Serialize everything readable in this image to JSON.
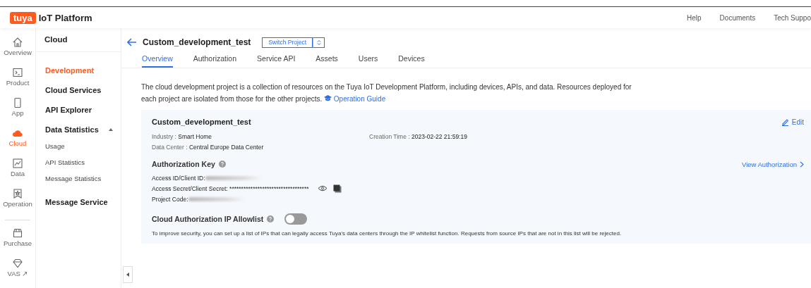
{
  "header": {
    "logo": "tuya",
    "title": "IoT Platform",
    "links": [
      "Help",
      "Documents",
      "Tech Suppo"
    ]
  },
  "rail": [
    {
      "label": "Overview",
      "selected": false
    },
    {
      "label": "Product",
      "selected": false
    },
    {
      "label": "App",
      "selected": false
    },
    {
      "label": "Cloud",
      "selected": true
    },
    {
      "label": "Data",
      "selected": false
    },
    {
      "label": "Operation",
      "selected": false
    },
    {
      "label": "Purchase",
      "selected": false
    },
    {
      "label": "VAS ↗",
      "selected": false
    }
  ],
  "sidebar": {
    "title": "Cloud",
    "items": [
      {
        "label": "Development",
        "selected": true
      },
      {
        "label": "Cloud Services",
        "selected": false
      },
      {
        "label": "API Explorer",
        "selected": false
      },
      {
        "label": "Data Statistics",
        "selected": false,
        "expanded": true,
        "children": [
          {
            "label": "Usage",
            "selected": false
          },
          {
            "label": "API Statistics",
            "selected": false
          },
          {
            "label": "Message Statistics",
            "selected": false
          }
        ]
      },
      {
        "label": "Message Service",
        "selected": false
      }
    ]
  },
  "project": {
    "name": "Custom_development_test",
    "switch_button": "Switch Project"
  },
  "tabs": [
    {
      "label": "Overview",
      "selected": true
    },
    {
      "label": "Authorization",
      "selected": false
    },
    {
      "label": "Service API",
      "selected": false
    },
    {
      "label": "Assets",
      "selected": false
    },
    {
      "label": "Users",
      "selected": false
    },
    {
      "label": "Devices",
      "selected": false
    }
  ],
  "intro": {
    "text": "The cloud development project is a collection of resources on the Tuya IoT Development Platform, including devices, APIs, and data. Resources deployed for each project are isolated from those for the other projects.",
    "link": "Operation Guide"
  },
  "card": {
    "title": "Custom_development_test",
    "edit": "Edit",
    "info": [
      {
        "label": "Industry : ",
        "value": "Smart Home"
      },
      {
        "label": "Creation Time : ",
        "value": "2023-02-22 21:59:19"
      },
      {
        "label": "Data Center : ",
        "value": "Central Europe Data Center"
      }
    ],
    "auth_title": "Authorization Key",
    "view_auth": "View Authorization",
    "keys": [
      {
        "label": "Access ID/Client ID:",
        "kind": "blurred"
      },
      {
        "label": "Access Secret/Client Secret: ",
        "value": "**********************************",
        "kind": "secret"
      },
      {
        "label": "Project Code:",
        "kind": "blurred"
      }
    ],
    "allowlist": {
      "title": "Cloud Authorization IP Allowlist",
      "on": false,
      "note": "To improve security, you can set up a list of IPs that can legally access Tuya's data centers through the IP whitelist function. Requests from source IPs that are not in this list will be rejected."
    }
  }
}
